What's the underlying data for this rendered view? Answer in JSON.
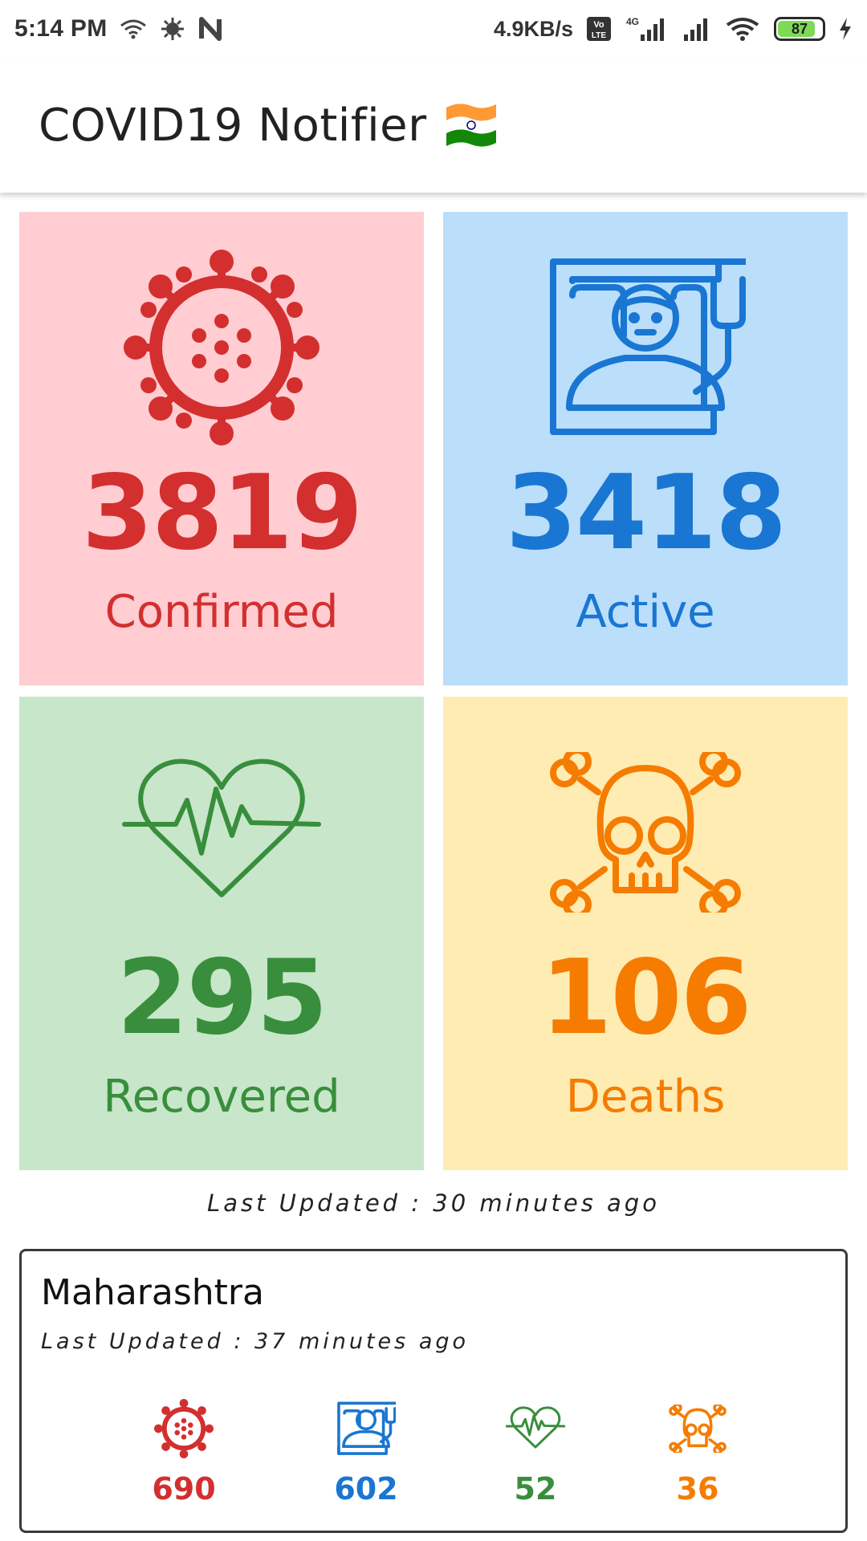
{
  "status_bar": {
    "time": "5:14 PM",
    "net_speed": "4.9KB/s",
    "network_type": "4G",
    "volte_label": "Vo LTE",
    "battery_percent": "87",
    "icons": [
      "wifi-icon",
      "bug-icon",
      "n-notification-icon",
      "volte-icon",
      "signal-icon",
      "signal-icon",
      "wifi-icon",
      "battery-icon",
      "charging-icon"
    ]
  },
  "app_bar": {
    "title": "COVID19 Notifier",
    "flag_icon": "india-flag-icon"
  },
  "national": {
    "confirmed": {
      "count": "3819",
      "label": "Confirmed",
      "icon": "virus-icon",
      "color": "#d32f2f",
      "bg": "#ffcdd2"
    },
    "active": {
      "count": "3418",
      "label": "Active",
      "icon": "hospital-bed-patient-icon",
      "color": "#1976d2",
      "bg": "#bbdefb"
    },
    "recovered": {
      "count": "295",
      "label": "Recovered",
      "icon": "heartbeat-icon",
      "color": "#388e3c",
      "bg": "#c8e6c9"
    },
    "deaths": {
      "count": "106",
      "label": "Deaths",
      "icon": "skull-crossbones-icon",
      "color": "#f57c00",
      "bg": "#ffecb3"
    },
    "last_updated": "Last Updated : 30 minutes ago"
  },
  "states": [
    {
      "name": "Maharashtra",
      "last_updated": "Last Updated : 37 minutes ago",
      "confirmed": "690",
      "active": "602",
      "recovered": "52",
      "deaths": "36"
    }
  ]
}
